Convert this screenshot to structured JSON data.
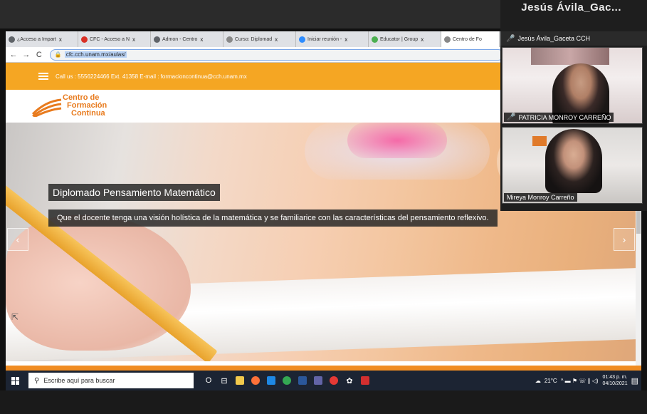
{
  "zoom_top_name": "Jesús  Ávila_Gac...",
  "browser": {
    "tabs": [
      {
        "label": "¿Acceso a Impart",
        "icon_color": "#5f6368",
        "active": false
      },
      {
        "label": "CFC - Acceso a N",
        "icon_color": "#d93025",
        "active": false
      },
      {
        "label": "Admon - Centro",
        "icon_color": "#5f6368",
        "active": false
      },
      {
        "label": "Curso: Diplomad",
        "icon_color": "#888888",
        "active": false
      },
      {
        "label": "Iniciar reunión -",
        "icon_color": "#2d8cff",
        "active": false
      },
      {
        "label": "Educator | Group",
        "icon_color": "#4caf50",
        "active": false
      },
      {
        "label": "Centro de Fo",
        "icon_color": "#888888",
        "active": true
      }
    ],
    "close_glyph": "x",
    "back": "←",
    "forward": "→",
    "reload": "C",
    "lock": "🔒",
    "url": "cfc.cch.unam.mx/aulas/"
  },
  "site": {
    "contact": "Call us : 5556224466 Ext. 41358  E-mail : formacioncontinua@cch.unam.mx",
    "logo": {
      "line1": "Centro de",
      "line2": "Formación",
      "line3": "Continua"
    },
    "caption_title": "Diplomado Pensamiento Matemático",
    "caption_text": "Que el docente tenga una visión holística de la matemática y se familiarice con las características del pensamiento reflexivo.",
    "prev": "‹",
    "next": "›",
    "cursor": "⇱"
  },
  "zoom": {
    "host": "Jesús Ávila_Gaceta CCH",
    "participants": [
      {
        "name": "PATRICIA MONROY CARREÑO",
        "muted": true
      },
      {
        "name": "Mireya Monroy Carreño",
        "muted": false
      }
    ],
    "mic_icon": "🎤"
  },
  "taskbar": {
    "search_placeholder": "Escribe aquí para buscar",
    "search_glass": "⚲",
    "apps": [
      {
        "name": "cortana",
        "color": "#ffffff",
        "glyph": "O"
      },
      {
        "name": "task-view",
        "color": "#ffffff",
        "glyph": "⊟"
      },
      {
        "name": "explorer",
        "color": "#f2c94c",
        "glyph": ""
      },
      {
        "name": "firefox",
        "color": "#ff7139",
        "glyph": ""
      },
      {
        "name": "app-blue",
        "color": "#1e88e5",
        "glyph": ""
      },
      {
        "name": "chrome",
        "color": "#34a853",
        "glyph": ""
      },
      {
        "name": "word",
        "color": "#2b579a",
        "glyph": ""
      },
      {
        "name": "teams",
        "color": "#6264a7",
        "glyph": ""
      },
      {
        "name": "app-red",
        "color": "#e53935",
        "glyph": ""
      },
      {
        "name": "settings",
        "color": "#ffffff",
        "glyph": "✿"
      },
      {
        "name": "acrobat",
        "color": "#d32f2f",
        "glyph": ""
      }
    ],
    "weather": "21°C",
    "tray_glyphs": "^  ▬  ⚑  ☏  ∥  ◁)",
    "time": "01:43 p. m.",
    "date": "04/10/2021",
    "notif": "▤"
  }
}
